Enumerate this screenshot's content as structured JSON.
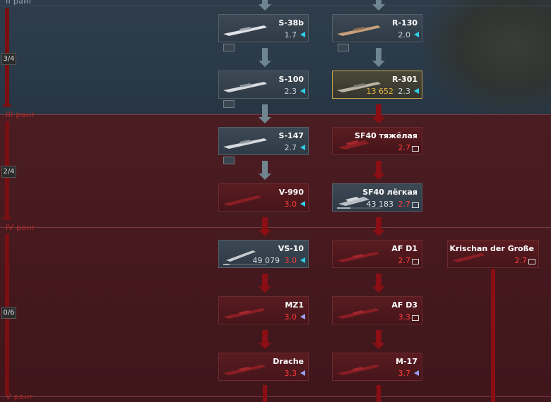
{
  "ranks": [
    {
      "label": "II ранг"
    },
    {
      "label": "III ранг"
    },
    {
      "label": "IV ранг"
    },
    {
      "label": "V ранг"
    }
  ],
  "progress": [
    {
      "text": "3/4"
    },
    {
      "text": "2/4"
    },
    {
      "text": "0/6"
    }
  ],
  "vehicles": {
    "s38b": {
      "name": "S-38b",
      "br": "1.7",
      "indicator": "cyan-triangle"
    },
    "r130": {
      "name": "R-130",
      "br": "2.0",
      "indicator": "cyan-triangle"
    },
    "s100": {
      "name": "S-100",
      "br": "2.3",
      "indicator": "cyan-triangle"
    },
    "r301": {
      "name": "R-301",
      "br": "2.3",
      "rp": "13 652",
      "indicator": "cyan-triangle"
    },
    "s147": {
      "name": "S-147",
      "br": "2.7",
      "indicator": "cyan-triangle"
    },
    "sf40h": {
      "name": "SF40 тяжёлая",
      "br": "2.7",
      "indicator": "box"
    },
    "v990": {
      "name": "V-990",
      "br": "3.0",
      "indicator": "cyan-triangle"
    },
    "sf40l": {
      "name": "SF40 лёгкая",
      "br": "2.7",
      "rp": "43 183",
      "indicator": "box"
    },
    "vs10": {
      "name": "VS-10",
      "br": "3.0",
      "rp": "49 079",
      "indicator": "cyan-triangle"
    },
    "afd1": {
      "name": "AF D1",
      "br": "2.7",
      "indicator": "box"
    },
    "krischan": {
      "name": "Krischan der Große",
      "br": "2.7",
      "indicator": "box"
    },
    "mz1": {
      "name": "MZ1",
      "br": "3.0",
      "indicator": "purple-triangle"
    },
    "afd3": {
      "name": "AF D3",
      "br": "3.3",
      "indicator": "box"
    },
    "drache": {
      "name": "Drache",
      "br": "3.3",
      "indicator": "purple-triangle"
    },
    "m17": {
      "name": "M-17",
      "br": "3.7",
      "indicator": "purple-triangle"
    }
  },
  "colors": {
    "br_locked": "#ff3a3a",
    "indicator_cyan": "#2fd1e6",
    "indicator_purple": "#9aa0f0",
    "premium_border": "#c9a34a"
  }
}
